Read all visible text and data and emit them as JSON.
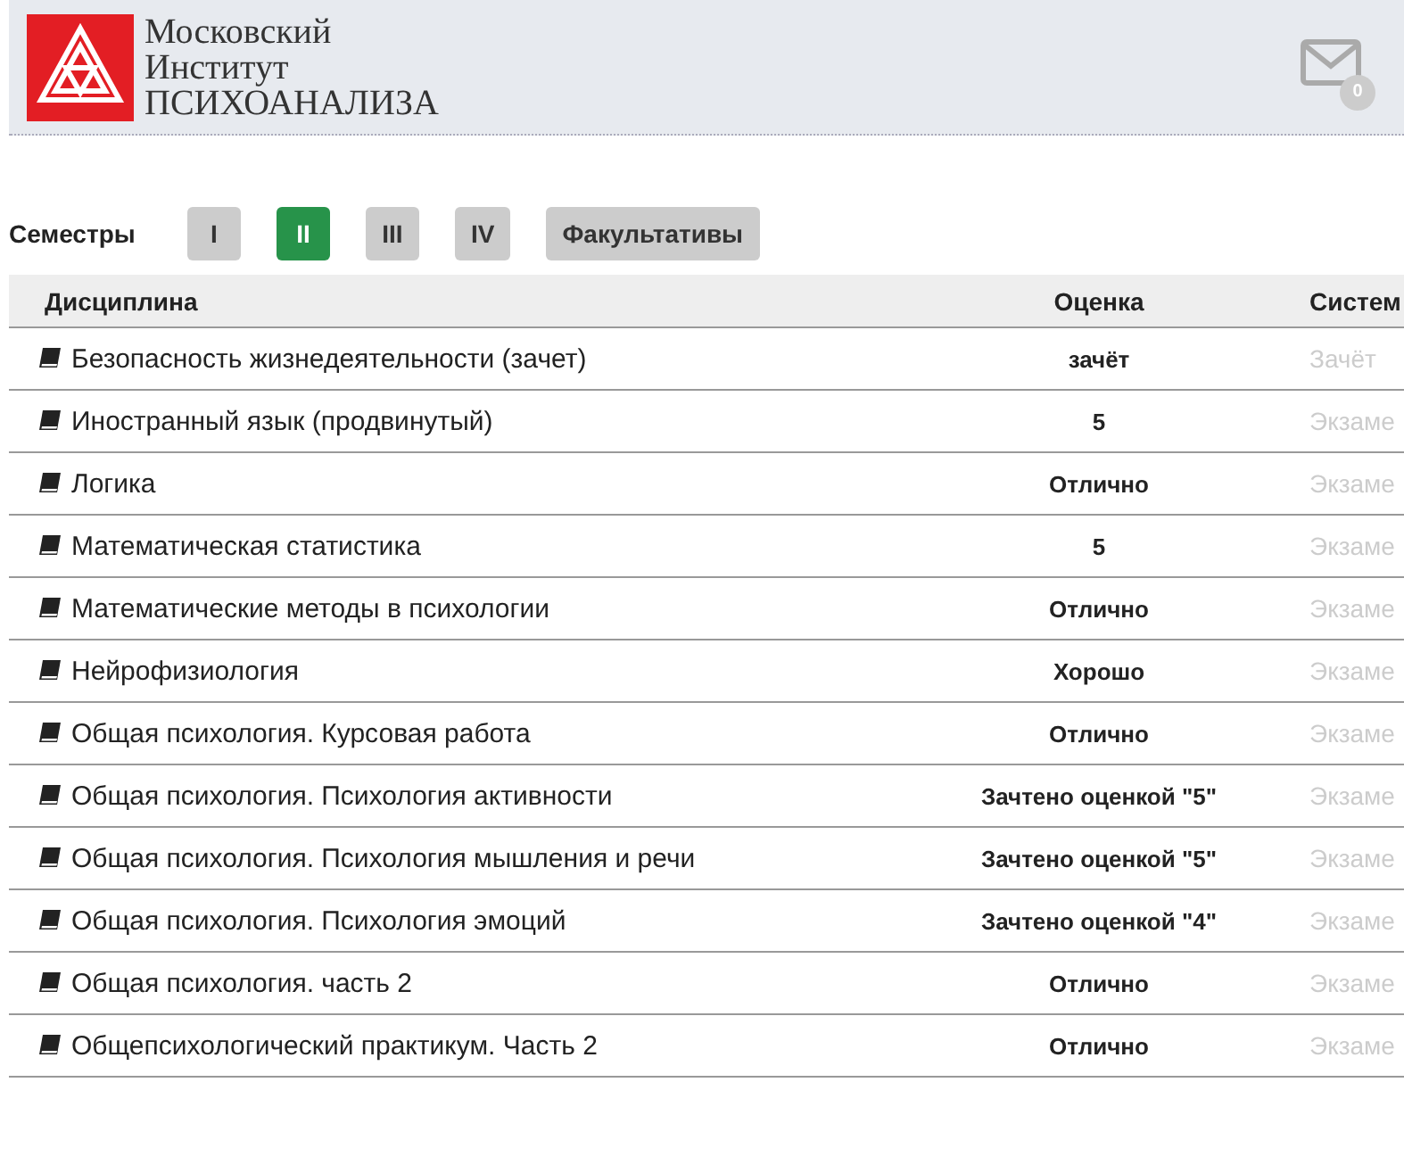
{
  "header": {
    "logo_lines": [
      "Московский",
      "Институт",
      "ПСИХОАНАЛИЗА"
    ],
    "mail_count": "0"
  },
  "semesters": {
    "label": "Семестры",
    "tabs": [
      {
        "label": "I",
        "selected": false
      },
      {
        "label": "II",
        "selected": true
      },
      {
        "label": "III",
        "selected": false
      },
      {
        "label": "IV",
        "selected": false
      },
      {
        "label": "Факультативы",
        "selected": false
      }
    ]
  },
  "table": {
    "columns": [
      "Дисциплина",
      "Оценка",
      "Систем"
    ],
    "rows": [
      {
        "discipline": "Безопасность жизнедеятельности (зачет)",
        "grade": "зачёт",
        "system": "Зачёт"
      },
      {
        "discipline": "Иностранный язык (продвинутый)",
        "grade": "5",
        "system": "Экзаме"
      },
      {
        "discipline": "Логика",
        "grade": "Отлично",
        "system": "Экзаме"
      },
      {
        "discipline": "Математическая статистика",
        "grade": "5",
        "system": "Экзаме"
      },
      {
        "discipline": "Математические методы в психологии",
        "grade": "Отлично",
        "system": "Экзаме"
      },
      {
        "discipline": "Нейрофизиология",
        "grade": "Хорошо",
        "system": "Экзаме"
      },
      {
        "discipline": "Общая психология. Курсовая работа",
        "grade": "Отлично",
        "system": "Экзаме"
      },
      {
        "discipline": "Общая психология. Психология активности",
        "grade": "Зачтено оценкой \"5\"",
        "system": "Экзаме"
      },
      {
        "discipline": "Общая психология. Психология мышления и речи",
        "grade": "Зачтено оценкой \"5\"",
        "system": "Экзаме"
      },
      {
        "discipline": "Общая психология. Психология эмоций",
        "grade": "Зачтено оценкой \"4\"",
        "system": "Экзаме"
      },
      {
        "discipline": "Общая психология. часть 2",
        "grade": "Отлично",
        "system": "Экзаме"
      },
      {
        "discipline": "Общепсихологический практикум. Часть 2",
        "grade": "Отлично",
        "system": "Экзаме"
      }
    ]
  }
}
